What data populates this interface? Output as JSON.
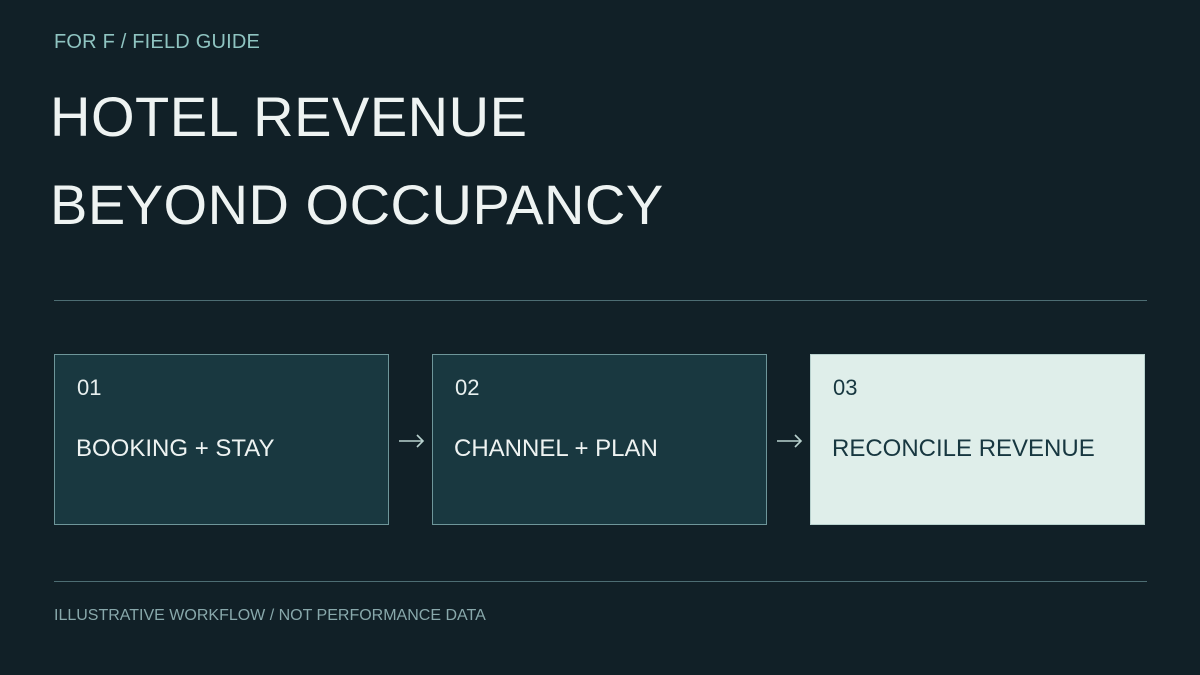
{
  "header": {
    "eyebrow": "FOR F / FIELD GUIDE",
    "title_line_1": "HOTEL REVENUE",
    "title_line_2": "BEYOND OCCUPANCY"
  },
  "workflow": {
    "steps": [
      {
        "number": "01",
        "label": "BOOKING + STAY"
      },
      {
        "number": "02",
        "label": "CHANNEL + PLAN"
      },
      {
        "number": "03",
        "label": "RECONCILE REVENUE"
      }
    ],
    "connector_icon": "right-arrow-icon"
  },
  "footer": {
    "note": "ILLUSTRATIVE WORKFLOW / NOT PERFORMANCE DATA"
  },
  "colors": {
    "background": "#112027",
    "step_fill": "#193840",
    "step_highlight_fill": "#dfeeea",
    "accent_text": "#8fc4c1"
  }
}
